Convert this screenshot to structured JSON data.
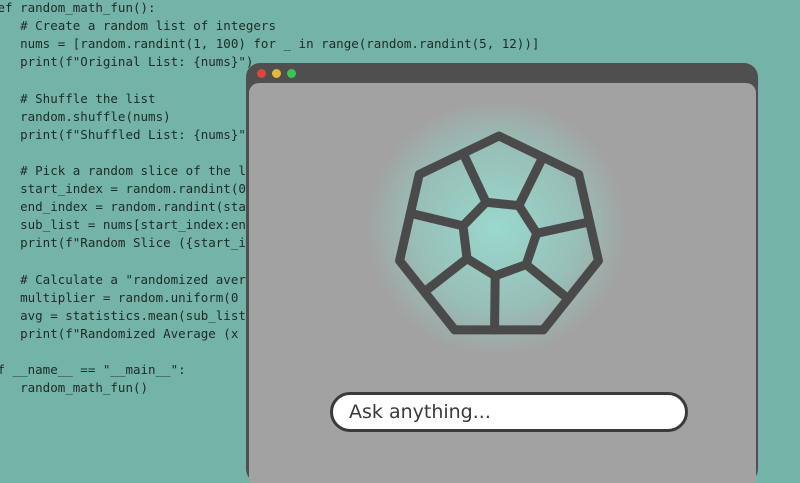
{
  "code_lines": [
    "def random_math_fun():",
    "    # Create a random list of integers",
    "    nums = [random.randint(1, 100) for _ in range(random.randint(5, 12))]",
    "    print(f\"Original List: {nums}\")",
    "",
    "    # Shuffle the list",
    "    random.shuffle(nums)",
    "    print(f\"Shuffled List: {nums}\")",
    "",
    "    # Pick a random slice of the list",
    "    start_index = random.randint(0",
    "    end_index = random.randint(start",
    "    sub_list = nums[start_index:end",
    "    print(f\"Random Slice ({start_i",
    "",
    "    # Calculate a \"randomized aver",
    "    multiplier = random.uniform(0",
    "    avg = statistics.mean(sub_list",
    "    print(f\"Randomized Average (x",
    "",
    "if __name__ == \"__main__\":",
    "    random_math_fun()"
  ],
  "window": {
    "traffic_lights": [
      "close",
      "minimize",
      "maximize"
    ],
    "logo_icon": "aperture-heptagon-icon",
    "ask_placeholder": "Ask anything..."
  },
  "colors": {
    "background": "#74b4a8",
    "window_frame": "#4f4f4f",
    "panel": "#a2a2a2",
    "logo_stroke": "#4a4a4a",
    "glow": "#96ebdc"
  }
}
